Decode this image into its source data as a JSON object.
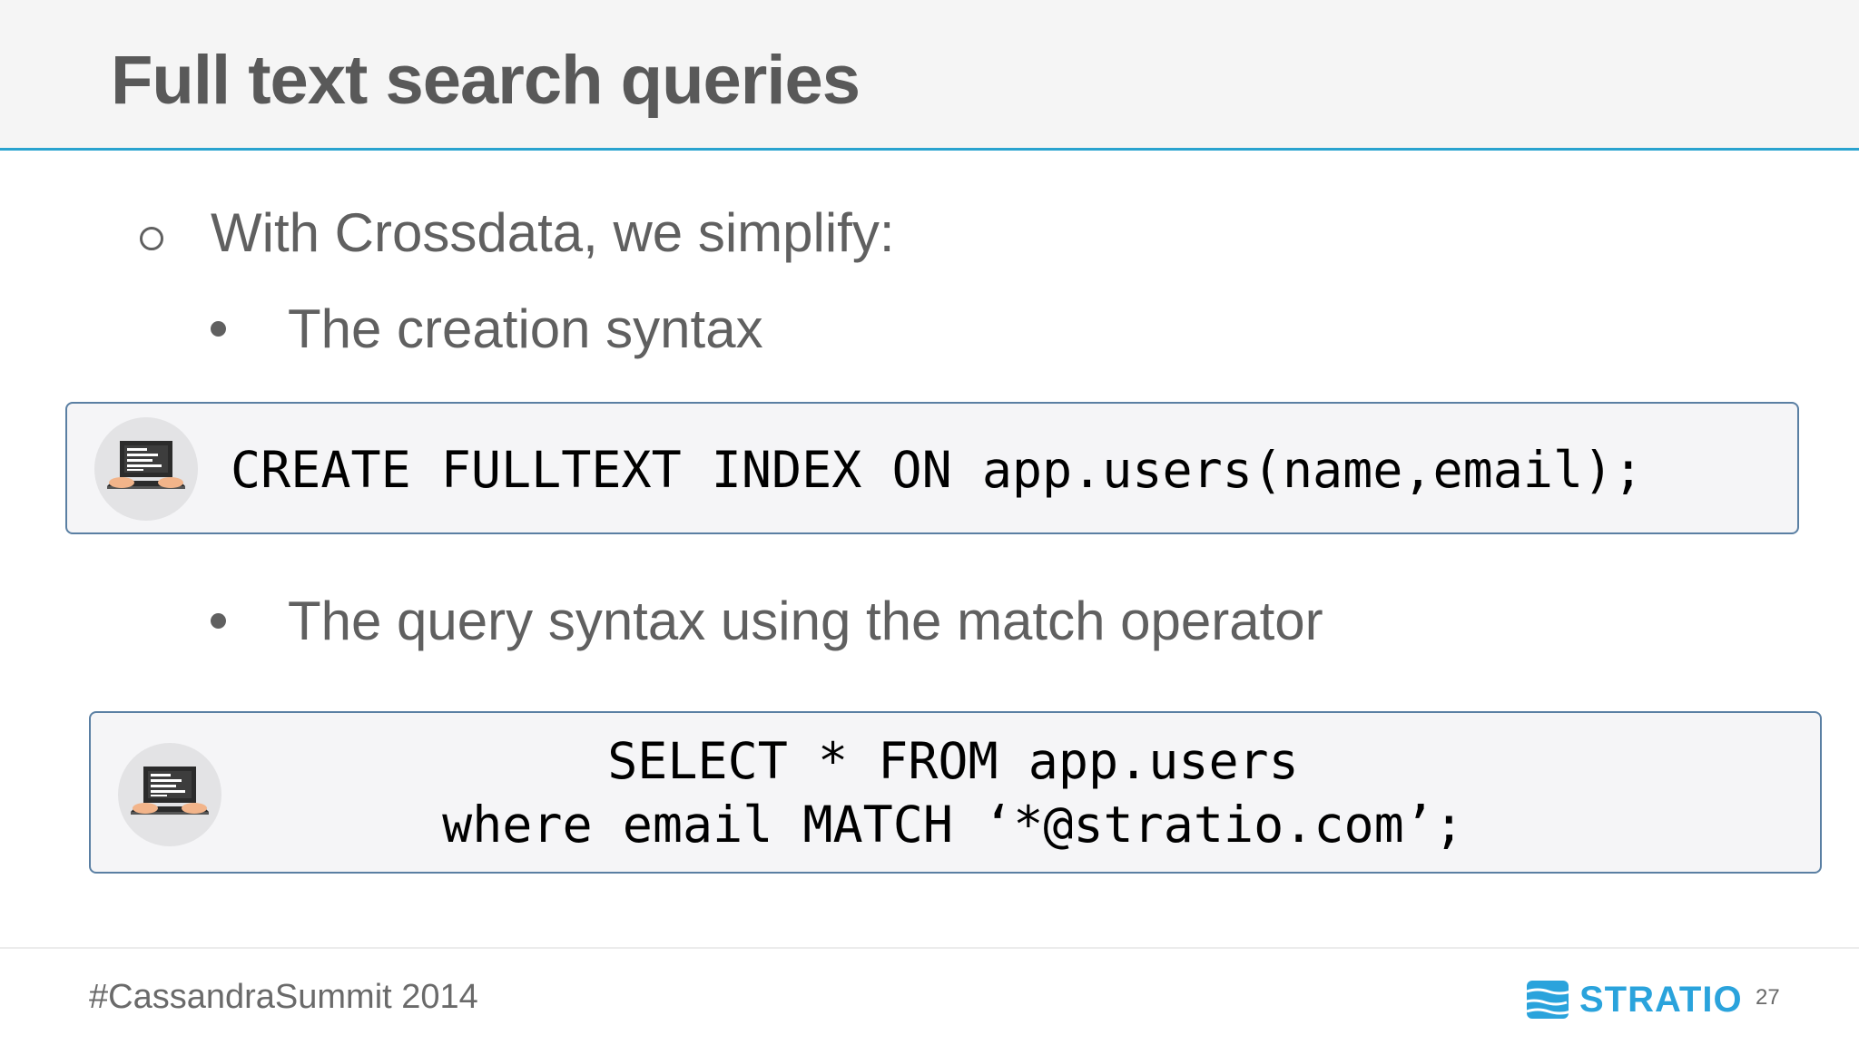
{
  "slide": {
    "title": "Full text search queries",
    "bullet_main": "With Crossdata, we simplify:",
    "bullet_creation": "The creation syntax",
    "bullet_query": "The query syntax using the match operator"
  },
  "code_blocks": [
    {
      "icon": "laptop-icon",
      "lines": [
        "CREATE FULLTEXT INDEX ON app.users(name,email);"
      ]
    },
    {
      "icon": "laptop-icon",
      "lines": [
        "SELECT * FROM app.users",
        "where email MATCH ‘*@stratio.com’;"
      ]
    }
  ],
  "footer": {
    "hashtag": "#CassandraSummit 2014",
    "brand_name": "STRATIO",
    "page_number": "27"
  },
  "colors": {
    "accent": "#2aa3cf",
    "brand": "#2aa3dc",
    "code_border": "#5a7fa3",
    "code_background": "#f5f5f7"
  }
}
